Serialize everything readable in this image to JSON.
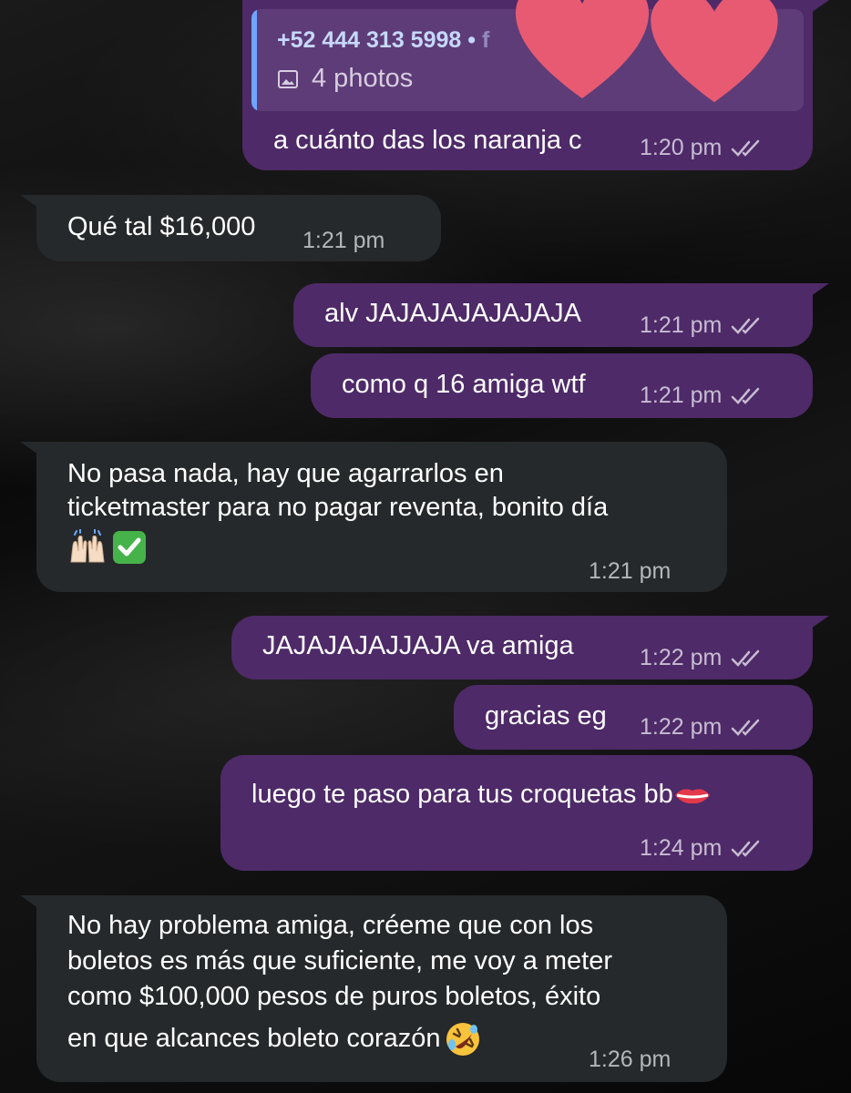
{
  "chat": {
    "reply_sender": "+52 444 313 5998 •",
    "reply_sender_obscured_tail": "f",
    "reply_attachment": "4 photos",
    "messages": [
      {
        "direction": "out",
        "text": "a cuánto das los naranja c",
        "time": "1:20 pm",
        "status": "read"
      },
      {
        "direction": "in",
        "text": "Qué tal $16,000",
        "time": "1:21 pm"
      },
      {
        "direction": "out",
        "text": "alv JAJAJAJAJAJAJA",
        "time": "1:21 pm",
        "status": "read"
      },
      {
        "direction": "out",
        "text": "como q 16 amiga wtf",
        "time": "1:21 pm",
        "status": "read"
      },
      {
        "direction": "in",
        "lines": [
          "No pasa nada, hay que agarrarlos en",
          "ticketmaster para no pagar reventa, bonito día"
        ],
        "emojis": [
          "raising-hands",
          "check-mark-button"
        ],
        "time": "1:21 pm"
      },
      {
        "direction": "out",
        "text": "JAJAJAJAJJAJA va amiga",
        "time": "1:22 pm",
        "status": "read"
      },
      {
        "direction": "out",
        "text": "gracias eg",
        "time": "1:22 pm",
        "status": "read"
      },
      {
        "direction": "out",
        "text": "luego te paso para tus croquetas bb",
        "emoji": "lips",
        "time": "1:24 pm",
        "status": "read"
      },
      {
        "direction": "in",
        "lines": [
          "No hay problema amiga, créeme que con los",
          "boletos es más que suficiente, me voy a meter",
          "como $100,000 pesos de puros boletos, éxito",
          "en que alcances boleto corazón"
        ],
        "emoji": "rolling-laughing",
        "time": "1:26 pm"
      }
    ]
  },
  "colors": {
    "outgoing_bubble": "#4e2a68",
    "incoming_bubble": "#25292b",
    "reply_accent": "#6ea5ff",
    "heart_sticker": "#e85a72"
  }
}
